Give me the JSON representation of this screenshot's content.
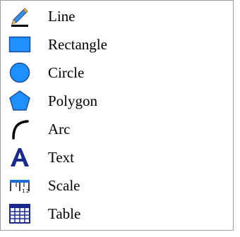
{
  "menu": {
    "items": [
      {
        "label": "Line",
        "icon": "pencil-line-icon"
      },
      {
        "label": "Rectangle",
        "icon": "rectangle-icon"
      },
      {
        "label": "Circle",
        "icon": "circle-icon"
      },
      {
        "label": "Polygon",
        "icon": "polygon-icon"
      },
      {
        "label": "Arc",
        "icon": "arc-icon"
      },
      {
        "label": "Text",
        "icon": "text-icon"
      },
      {
        "label": "Scale",
        "icon": "scale-ruler-icon"
      },
      {
        "label": "Table",
        "icon": "table-icon"
      }
    ]
  },
  "colors": {
    "shape_blue": "#1e90ff",
    "shape_stroke": "#1c4e9c",
    "text_icon_blue": "#1a2a8c",
    "menu_border": "#9d9d9d"
  }
}
